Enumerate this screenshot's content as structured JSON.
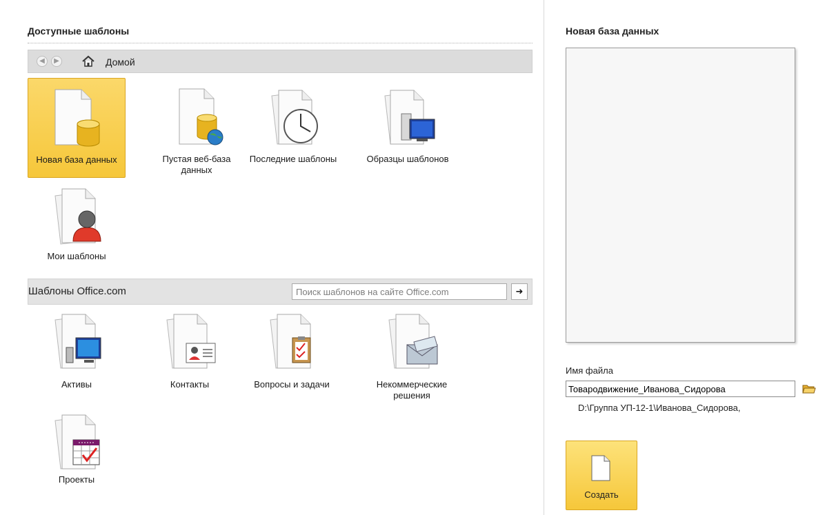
{
  "left": {
    "title": "Доступные шаблоны",
    "nav": {
      "home_label": "Домой",
      "back_icon": "arrow-left-icon",
      "forward_icon": "arrow-right-icon"
    },
    "templates": [
      {
        "label": "Новая база данных",
        "icon": "database-icon",
        "selected": true
      },
      {
        "label": "Пустая веб-база данных",
        "icon": "web-database-icon"
      },
      {
        "label": "Последние шаблоны",
        "icon": "clock-icon"
      },
      {
        "label": "Образцы шаблонов",
        "icon": "computer-icon"
      },
      {
        "label": "Мои шаблоны",
        "icon": "person-icon"
      }
    ],
    "office": {
      "title": "Шаблоны Office.com",
      "search_placeholder": "Поиск шаблонов на сайте Office.com",
      "search_go": "➜",
      "templates": [
        {
          "label": "Активы",
          "icon": "assets-icon"
        },
        {
          "label": "Контакты",
          "icon": "contact-card-icon"
        },
        {
          "label": "Вопросы и задачи",
          "icon": "clipboard-icon"
        },
        {
          "label": "Некоммерческие решения",
          "icon": "envelope-icon"
        },
        {
          "label": "Проекты",
          "icon": "calendar-icon"
        }
      ]
    }
  },
  "right": {
    "title": "Новая база данных",
    "filename_label": "Имя файла",
    "filename_value": "Товародвижение_Иванова_Сидорова",
    "path": "D:\\Группа УП-12-1\\Иванова_Сидорова,",
    "create_label": "Создать"
  },
  "colors": {
    "selected": "#f6c73a",
    "accent_border": "#d9a521",
    "nav_bg": "#dcdcdc"
  }
}
